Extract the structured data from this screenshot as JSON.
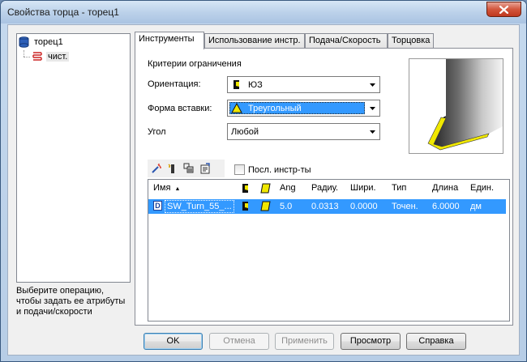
{
  "window": {
    "title": "Свойства торца - торец1"
  },
  "tree": {
    "items": [
      {
        "label": "торец1"
      },
      {
        "label": "чист."
      }
    ]
  },
  "hint": "Выберите операцию, чтобы задать ее атрибуты и подачи/скорости",
  "tabs": [
    {
      "label": "Инструменты"
    },
    {
      "label": "Использование инстр."
    },
    {
      "label": "Подача/Скорость"
    },
    {
      "label": "Торцовка"
    }
  ],
  "panel": {
    "criteria_label": "Критерии ограничения",
    "orientation": {
      "label": "Ориентация:",
      "value": "ЮЗ"
    },
    "insert_shape": {
      "label": "Форма вставки:",
      "value": "Треугольный"
    },
    "angle": {
      "label": "Угол",
      "value": "Любой"
    },
    "checkbox_label": "Посл. инстр-ты"
  },
  "list": {
    "columns": [
      "Имя",
      "",
      "",
      "Ang",
      "Радиу.",
      "Шири.",
      "Тип",
      "Длина",
      "Един."
    ],
    "sort_indicator": "▲",
    "rows": [
      {
        "icon": "D",
        "name": "SW_Turn_55_...",
        "ang": "5.0",
        "radius": "0.0313",
        "width": "0.0000",
        "type": "Точен.",
        "length": "6.0000",
        "units": "дм"
      }
    ]
  },
  "buttons": {
    "ok": "OK",
    "cancel": "Отмена",
    "apply": "Применить",
    "preview": "Просмотр",
    "help": "Справка"
  },
  "colors": {
    "accent": "#3399ff",
    "insert_yellow": "#f0e800"
  }
}
